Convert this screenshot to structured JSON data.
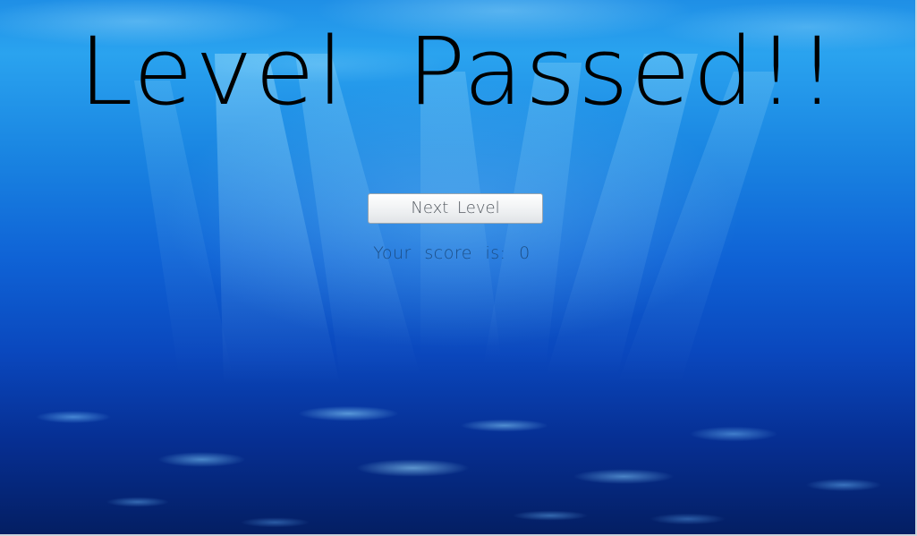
{
  "screen": {
    "title": "Level Passed!!",
    "next_button_label": "Next Level",
    "score_label": "Your score is:",
    "score_value": "0"
  },
  "colors": {
    "title": "#000000",
    "button_text": "#555b62",
    "score_text": "#1c4e86",
    "water_top": "#2aa3ef",
    "water_bottom": "#041e62"
  }
}
